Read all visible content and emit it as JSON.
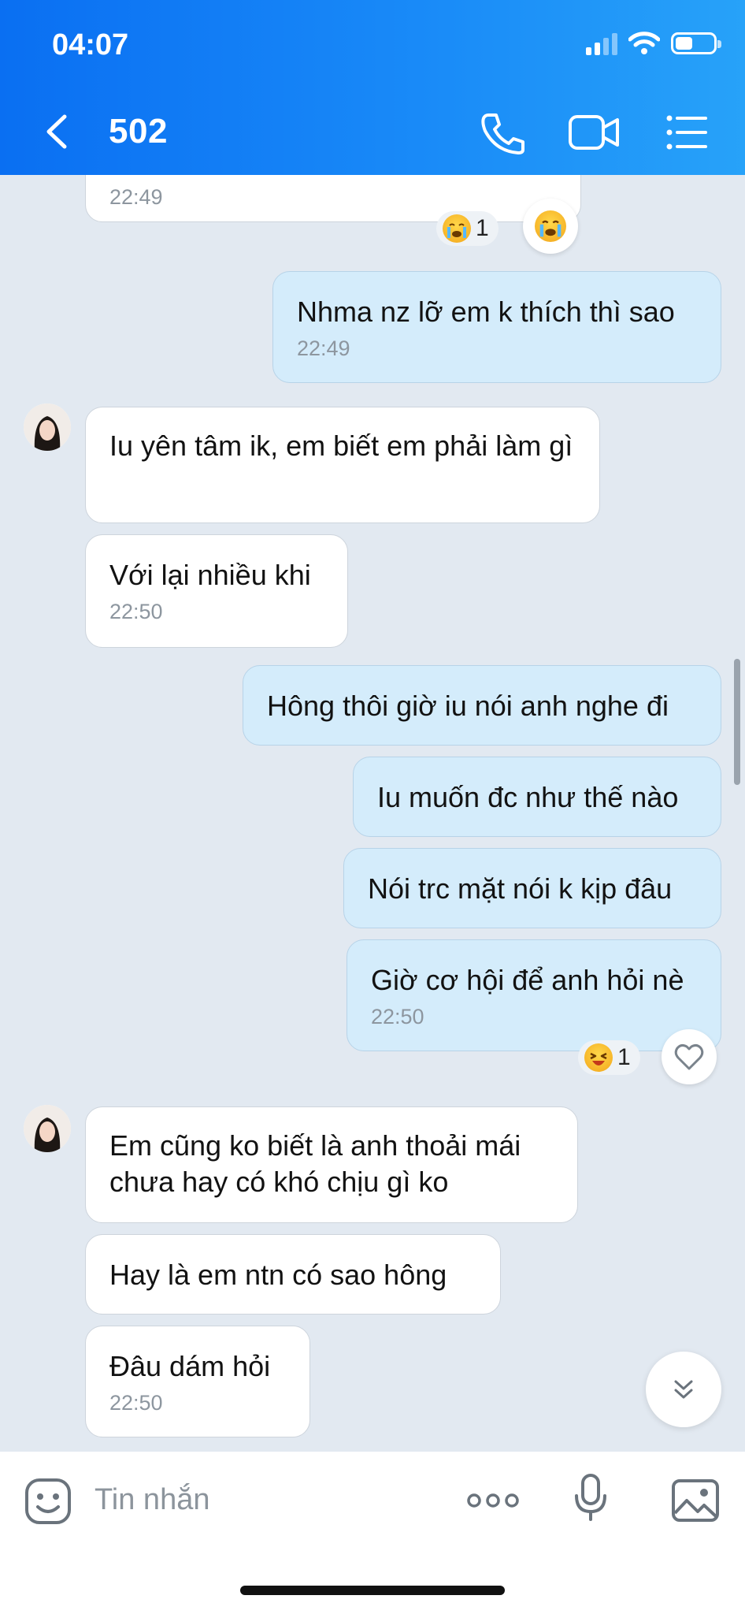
{
  "status_bar": {
    "time": "04:07"
  },
  "header": {
    "title": "502"
  },
  "messages": [
    {
      "time": "22:49"
    },
    {
      "text": "Nhma nz lỡ em k thích thì sao",
      "time": "22:49"
    },
    {
      "text": "Iu yên tâm ik, em biết em phải làm gì"
    },
    {
      "text": "Với lại nhiều khi",
      "time": "22:50"
    },
    {
      "text": "Hông thôi giờ iu nói anh nghe đi"
    },
    {
      "text": "Iu muốn đc như thế nào"
    },
    {
      "text": "Nói trc mặt nói k kịp đâu"
    },
    {
      "text": "Giờ cơ hội để anh hỏi nè",
      "time": "22:50"
    },
    {
      "text": "Em cũng ko biết là anh thoải mái chưa hay có khó chịu gì ko"
    },
    {
      "text": "Hay là em ntn có sao hông"
    },
    {
      "text": "Đâu dám hỏi",
      "time": "22:50"
    }
  ],
  "reactions": {
    "first": {
      "emoji": "crying-face",
      "count": "1"
    },
    "second": {
      "emoji": "laughing-face",
      "count": "1"
    }
  },
  "composer": {
    "placeholder": "Tin nhắn"
  },
  "colors": {
    "header": "#0a6ff2",
    "outgoing_bubble": "#d4ecfb",
    "incoming_bubble": "#ffffff",
    "background": "#e2e9f1"
  }
}
